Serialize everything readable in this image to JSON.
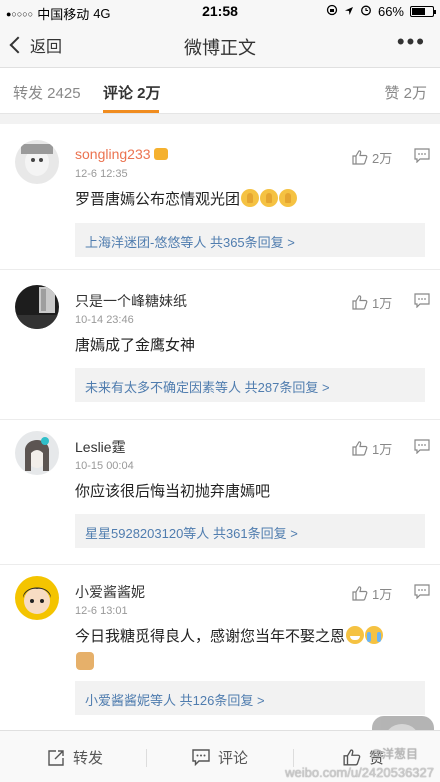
{
  "status_bar": {
    "carrier": "中国移动",
    "network": "4G",
    "time": "21:58",
    "battery": "66%",
    "battery_level": 0.66
  },
  "nav": {
    "back_label": "返回",
    "title": "微博正文",
    "more_label": "•••"
  },
  "tabs": {
    "repost": "转发 2425",
    "comments": "评论 2万",
    "likes": "赞 2万"
  },
  "comments": [
    {
      "username": "songling233",
      "username_color": "#eb7350",
      "time": "12-6 12:35",
      "text": "罗晋唐嫣公布恋情观光团",
      "emojis": [
        "pray",
        "pray",
        "pray"
      ],
      "likes": "2万",
      "replies": {
        "names": "上海洋迷团-悠悠等人",
        "count": "共365条回复 >"
      }
    },
    {
      "username": "只是一个峰糖妹纸",
      "username_color": "#333333",
      "time": "10-14 23:46",
      "text": "唐嫣成了金鹰女神",
      "emojis": [],
      "likes": "1万",
      "replies": {
        "names": "未来有太多不确定因素等人",
        "count": "共287条回复 >"
      }
    },
    {
      "username": "Leslie霆",
      "username_color": "#333333",
      "time": "10-15 00:04",
      "text": "你应该很后悔当初抛弃唐嫣吧",
      "emojis": [],
      "likes": "1万",
      "replies": {
        "names": "星星5928203120等人",
        "count": "共361条回复 >"
      }
    },
    {
      "username": "小爱酱酱妮",
      "username_color": "#333333",
      "time": "12-6 13:01",
      "text": "今日我糖觅得良人，感谢您当年不娶之恩",
      "emojis": [
        "grin",
        "cry",
        "doge"
      ],
      "likes": "1万",
      "replies": {
        "names": "小爱酱酱妮等人",
        "count": "共126条回复 >"
      }
    }
  ],
  "toolbar": {
    "repost": "转发",
    "comment": "评论",
    "like": "赞"
  },
  "watermark": {
    "handle": "@洋葱目",
    "url": "weibo.com/u/2420536327"
  },
  "colors": {
    "accent": "#f08c1f",
    "link": "#507daf",
    "orange_name": "#eb7350"
  }
}
